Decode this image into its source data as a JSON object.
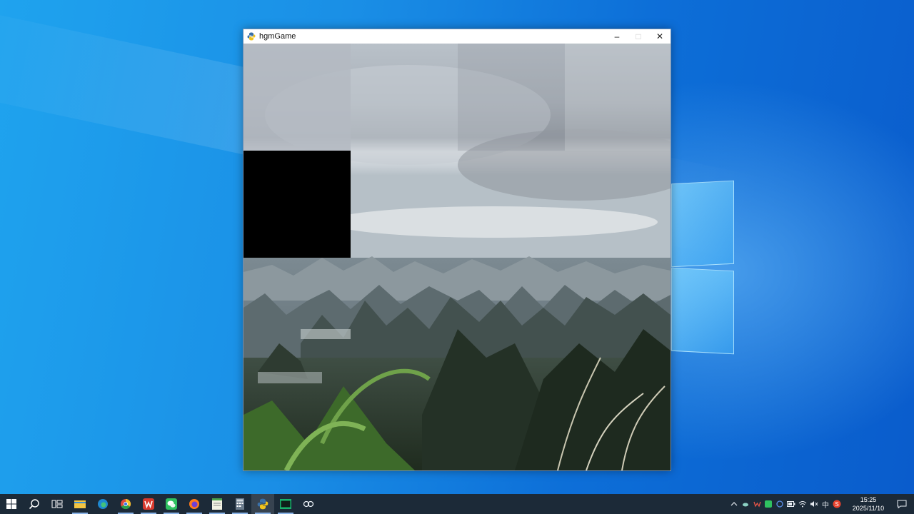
{
  "window": {
    "title": "hgmGame",
    "minimize_label": "–",
    "maximize_label": "□",
    "close_label": "✕"
  },
  "puzzle": {
    "grid": "4x4",
    "empty_tile": {
      "row": 1,
      "col": 0
    }
  },
  "taskbar": {
    "apps": [
      {
        "name": "start-icon"
      },
      {
        "name": "search-icon"
      },
      {
        "name": "task-view-icon"
      },
      {
        "name": "file-explorer-icon",
        "running": true
      },
      {
        "name": "edge-icon"
      },
      {
        "name": "chrome-icon",
        "running": true
      },
      {
        "name": "wps-icon",
        "running": true
      },
      {
        "name": "wechat-icon",
        "running": true
      },
      {
        "name": "firefox-icon",
        "running": true
      },
      {
        "name": "notepad-icon",
        "running": true
      },
      {
        "name": "calculator-icon",
        "running": true
      },
      {
        "name": "python-icon",
        "running": true,
        "active": true
      },
      {
        "name": "terminal-icon",
        "running": true
      },
      {
        "name": "link-icon"
      }
    ],
    "tray": {
      "ime_label": "中",
      "time": "15:25",
      "date": "2025/11/10"
    }
  }
}
